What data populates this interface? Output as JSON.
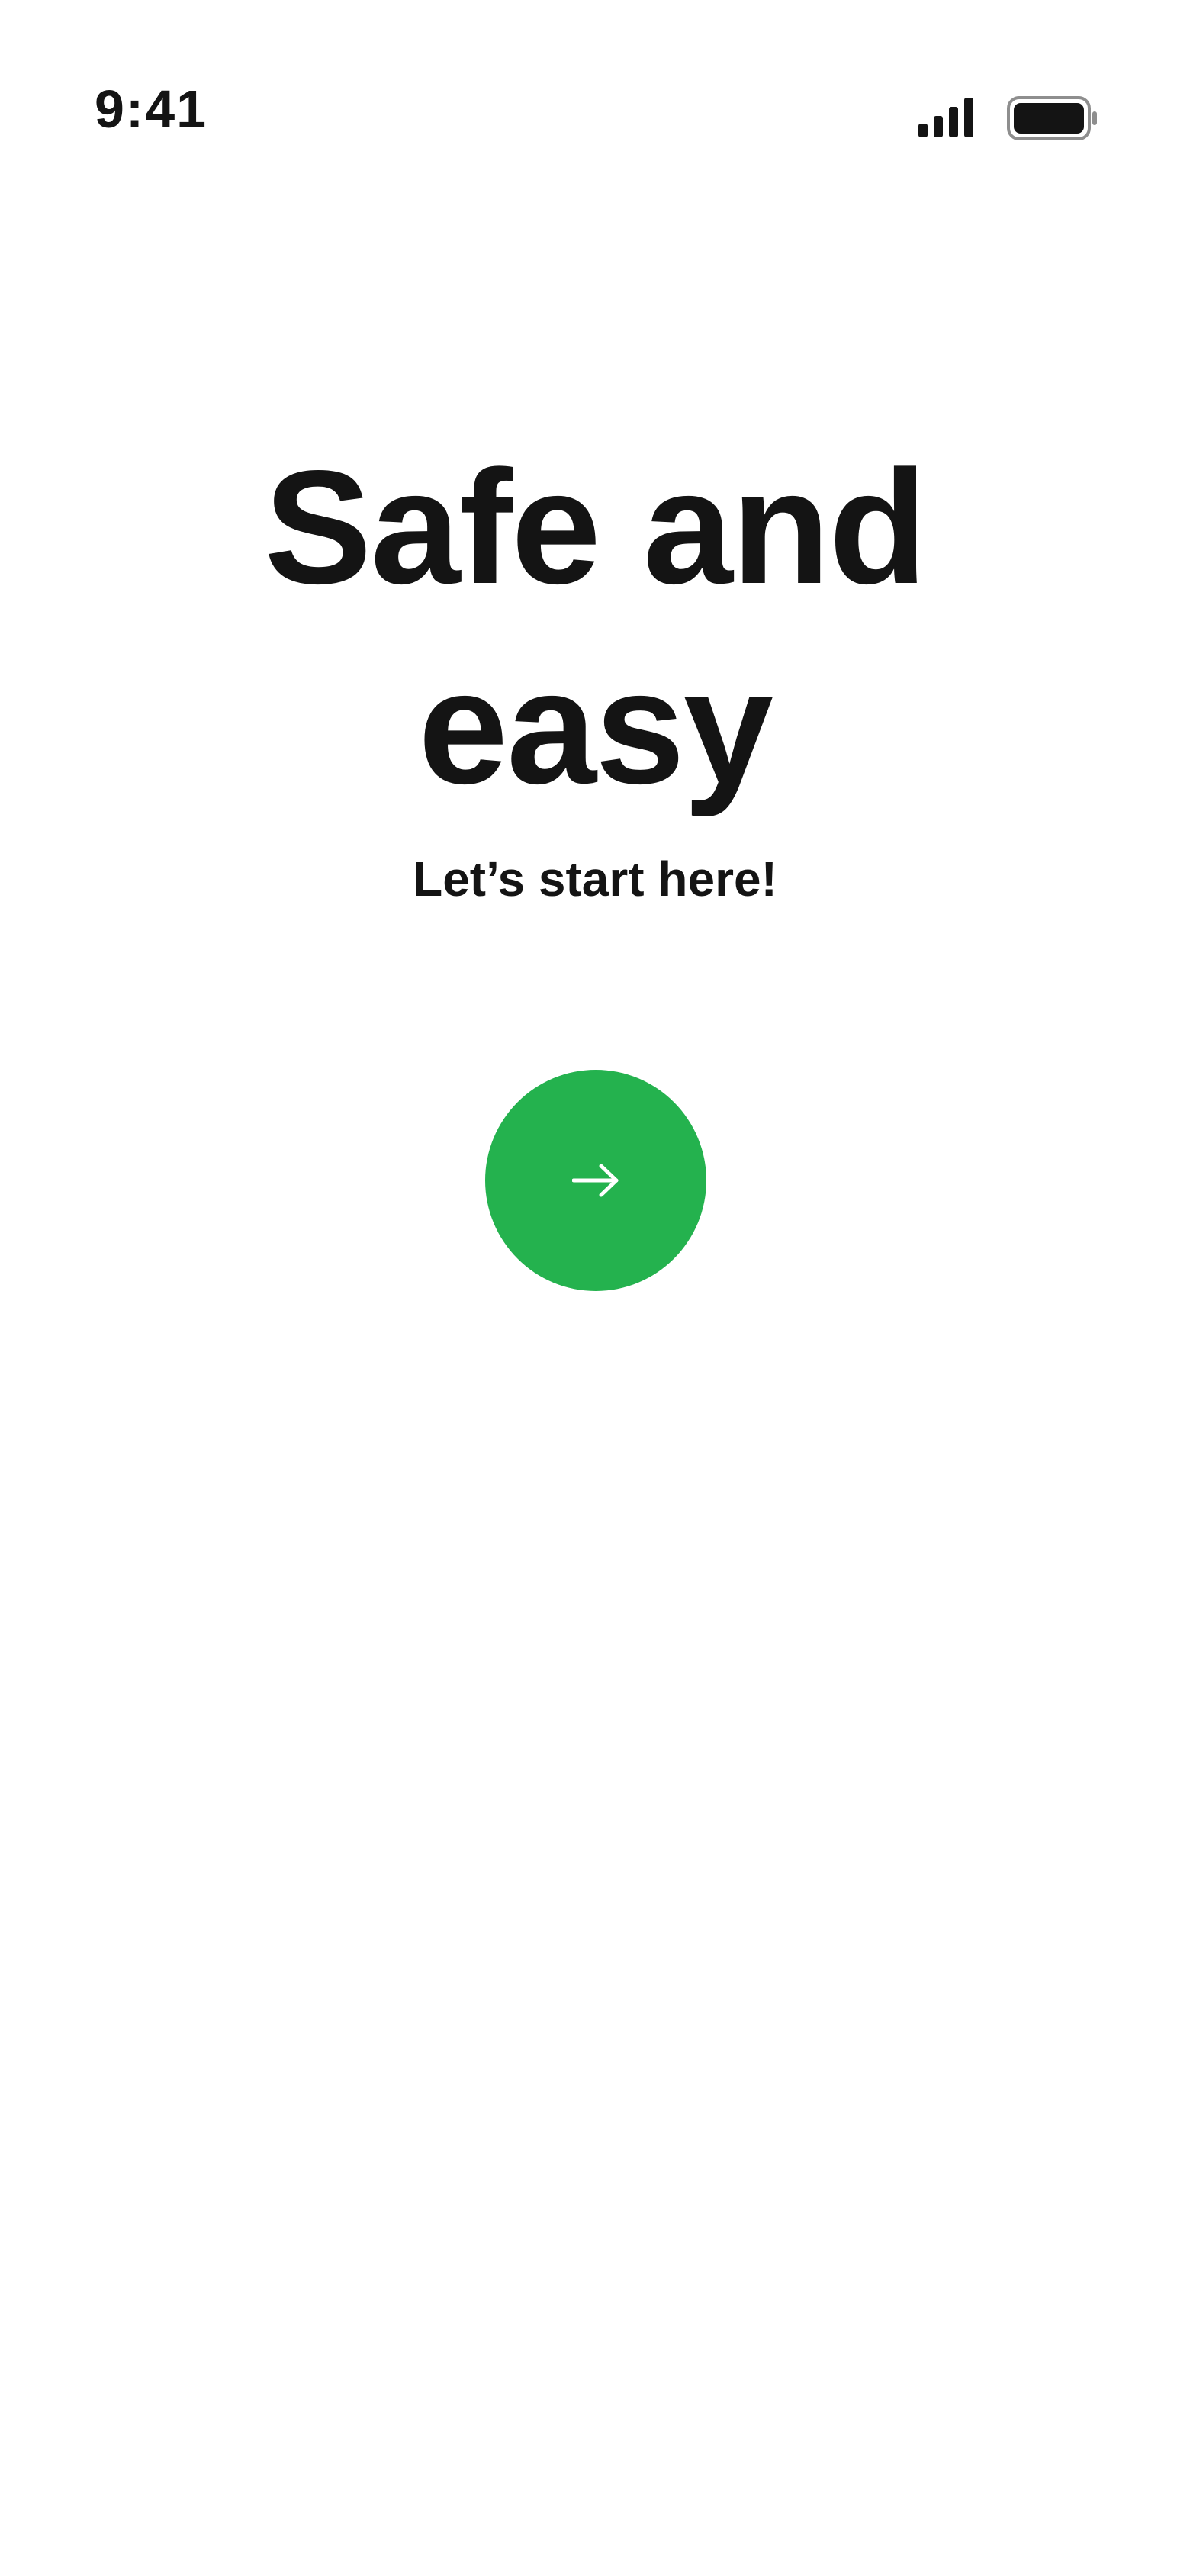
{
  "status_bar": {
    "time": "9:41",
    "signal_icon": "cellular-signal-icon",
    "battery_icon": "battery-full-icon"
  },
  "onboarding": {
    "headline_line1": "Safe and",
    "headline_line2": "easy",
    "subtitle": "Let’s start here!",
    "next_button_icon": "arrow-right-icon"
  },
  "colors": {
    "background": "#ffffff",
    "text": "#141414",
    "accent": "#24b24e"
  }
}
